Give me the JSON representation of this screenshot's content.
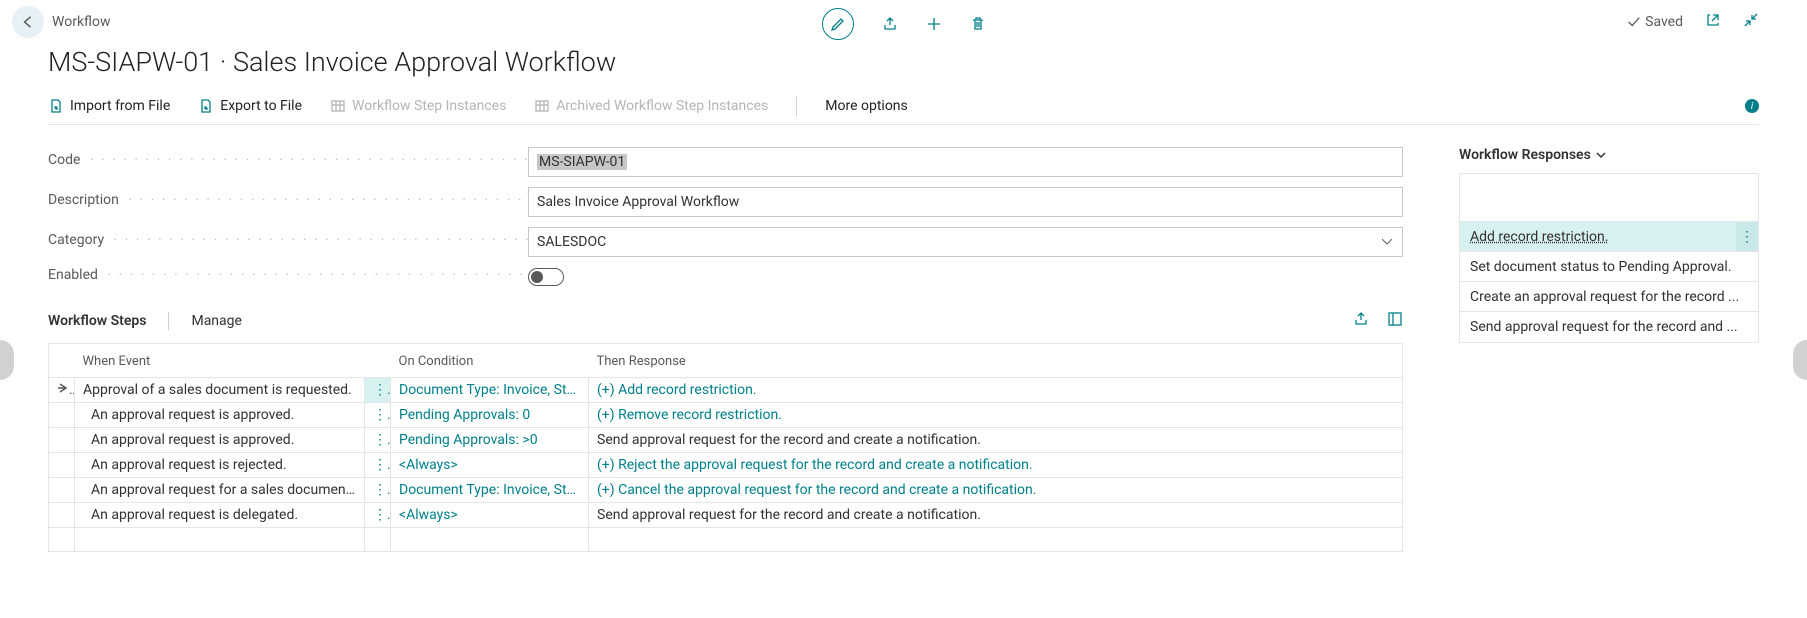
{
  "header": {
    "breadcrumb": "Workflow",
    "title": "MS-SIAPW-01 · Sales Invoice Approval Workflow",
    "saved_label": "Saved"
  },
  "commands": {
    "import": "Import from File",
    "export": "Export to File",
    "step_instances": "Workflow Step Instances",
    "archived_step_instances": "Archived Workflow Step Instances",
    "more_options": "More options"
  },
  "fields": {
    "code_label": "Code",
    "code_value": "MS-SIAPW-01",
    "description_label": "Description",
    "description_value": "Sales Invoice Approval Workflow",
    "category_label": "Category",
    "category_value": "SALESDOC",
    "enabled_label": "Enabled",
    "enabled_value": false
  },
  "steps_section": {
    "title": "Workflow Steps",
    "manage_label": "Manage",
    "columns": {
      "event": "When Event",
      "condition": "On Condition",
      "response": "Then Response"
    },
    "rows": [
      {
        "selected": true,
        "indent": 0,
        "event": "Approval of a sales document is requested.",
        "condition": "Document Type: Invoice, Status: O...",
        "condition_link": true,
        "response": "(+) Add record restriction.",
        "response_link": true
      },
      {
        "indent": 1,
        "event": "An approval request is approved.",
        "condition": "Pending Approvals: 0",
        "condition_link": true,
        "response": "(+) Remove record restriction.",
        "response_link": true
      },
      {
        "indent": 1,
        "event": "An approval request is approved.",
        "condition": "Pending Approvals: >0",
        "condition_link": true,
        "response": "Send approval request for the record and create a notification.",
        "response_link": false
      },
      {
        "indent": 1,
        "event": "An approval request is rejected.",
        "condition": "<Always>",
        "condition_link": true,
        "response": "(+) Reject the approval request for the record and create a notification.",
        "response_link": true
      },
      {
        "indent": 1,
        "event": "An approval request for a sales document is canc...",
        "condition": "Document Type: Invoice, Status: P...",
        "condition_link": true,
        "response": "(+) Cancel the approval request for the record and create a notification.",
        "response_link": true
      },
      {
        "indent": 1,
        "event": "An approval request is delegated.",
        "condition": "<Always>",
        "condition_link": true,
        "response": "Send approval request for the record and create a notification.",
        "response_link": false
      }
    ]
  },
  "responses_panel": {
    "title": "Workflow Responses",
    "items": [
      {
        "selected": true,
        "label": "Add record restriction."
      },
      {
        "selected": false,
        "label": "Set document status to Pending Approval."
      },
      {
        "selected": false,
        "label": "Create an approval request for the record ..."
      },
      {
        "selected": false,
        "label": "Send approval request for the record and ..."
      }
    ]
  }
}
